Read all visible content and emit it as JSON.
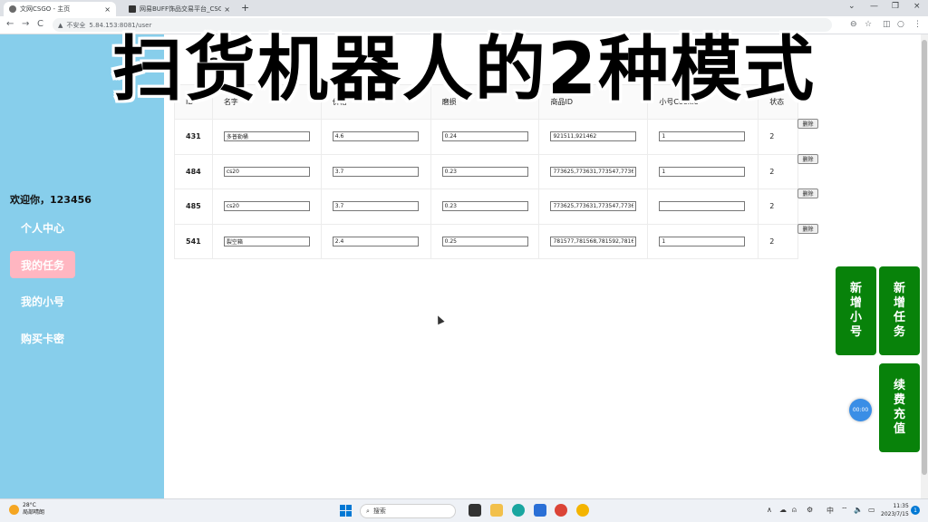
{
  "browser": {
    "tabs": [
      {
        "label": "文网CSGO - 主页",
        "close": "×"
      },
      {
        "label": "网易BUFF饰品交易平台_CSGO饰",
        "close": "×"
      }
    ],
    "new_tab": "+",
    "address": {
      "security": "不安全",
      "url": "5.84.153:8081/user"
    },
    "nav": {
      "back": "←",
      "forward": "→",
      "reload": "C"
    },
    "window_controls": {
      "dropdown": "⌄",
      "minimize": "—",
      "restore": "❐",
      "close": "×"
    },
    "toolbar_icons": {
      "zoom": "⊖",
      "star": "☆",
      "sidebar": "◫",
      "profile": "○",
      "menu": "⋮"
    }
  },
  "overlay_headline": "扫货机器人的2种模式",
  "page_title_partial": "SGO",
  "sidebar": {
    "welcome": "欢迎你，123456",
    "items": [
      {
        "label": "个人中心",
        "active": false
      },
      {
        "label": "我的任务",
        "active": true
      },
      {
        "label": "我的小号",
        "active": false
      },
      {
        "label": "购买卡密",
        "active": false
      }
    ]
  },
  "table": {
    "headers": [
      "ID",
      "名字",
      "价格",
      "磨损",
      "商品ID",
      "小号Cookie",
      "状态"
    ],
    "rows": [
      {
        "id": "431",
        "name": "多普勒桶",
        "price": "4.6",
        "wear": "0.24",
        "item_ids": "921511,921462",
        "cookie": "1",
        "status": "2"
      },
      {
        "id": "484",
        "name": "cs20",
        "price": "3.7",
        "wear": "0.23",
        "item_ids": "773625,773631,773547,7736",
        "cookie": "1",
        "status": "2"
      },
      {
        "id": "485",
        "name": "cs20",
        "price": "3.7",
        "wear": "0.23",
        "item_ids": "773625,773631,773547,7736",
        "cookie": "",
        "status": "2"
      },
      {
        "id": "541",
        "name": "裂空箱",
        "price": "2.4",
        "wear": "0.25",
        "item_ids": "781577,781568,781592,7816",
        "cookie": "1",
        "status": "2"
      }
    ],
    "delete_label": "删除"
  },
  "actions": {
    "add_account": [
      "新",
      "增",
      "小",
      "号"
    ],
    "add_task": [
      "新",
      "增",
      "任",
      "务"
    ],
    "recharge": [
      "续",
      "费",
      "充",
      "值"
    ],
    "timer": "00:00"
  },
  "taskbar": {
    "weather_temp": "28°C",
    "weather_desc": "局部晴朗",
    "search_placeholder": "搜索",
    "clock_time": "11:35",
    "clock_date": "2023/7/15",
    "notification_count": "1",
    "tray_icons": {
      "chevron": "∧",
      "cloud": "☁",
      "mic": "⍝",
      "settings": "⚙",
      "lang": "中",
      "wifi": "⌔",
      "volume": "🔈",
      "battery": "▭"
    }
  },
  "colors": {
    "sidebar_bg": "#87ceeb",
    "active_menu_bg": "#ffb6c1",
    "action_button_bg": "#08820a",
    "timer_bg": "#3a8ee6"
  }
}
